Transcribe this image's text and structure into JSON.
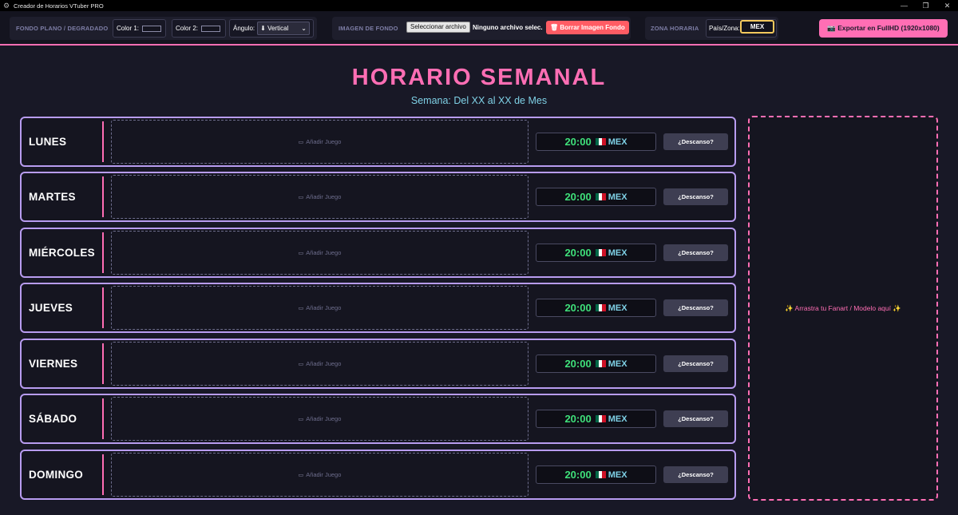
{
  "window": {
    "title": "Creador de Horarios VTuber PRO",
    "icon": "gear-icon",
    "controls": [
      "minimize-icon",
      "restore-icon",
      "close-icon"
    ]
  },
  "toolbar": {
    "bg_label": "FONDO PLANO / DEGRADADO",
    "color1_label": "Color 1:",
    "color1_value": "#14141f",
    "color2_label": "Color 2:",
    "color2_value": "#14141f",
    "angle_label": "Ángulo:",
    "angle_value": "⬇ Vertical",
    "image_label": "IMAGEN DE FONDO",
    "file_button": "Seleccionar archivo",
    "file_status": "Ninguno archivo selec.",
    "delete_image_button": "🗑 Borrar Imagen Fondo",
    "timezone_label": "ZONA HORARIA",
    "country_label": "País/Zona:",
    "country_value": "MEX",
    "export_button": "📷 Exportar en FullHD (1920x1080)"
  },
  "header": {
    "title": "HORARIO SEMANAL",
    "subtitle": "Semana: Del XX al XX de Mes"
  },
  "days": [
    {
      "name": "LUNES",
      "game_placeholder": "Añadir Juego",
      "time": "20:00",
      "zone": "MEX",
      "rest_button": "¿Descanso?"
    },
    {
      "name": "MARTES",
      "game_placeholder": "Añadir Juego",
      "time": "20:00",
      "zone": "MEX",
      "rest_button": "¿Descanso?"
    },
    {
      "name": "MIÉRCOLES",
      "game_placeholder": "Añadir Juego",
      "time": "20:00",
      "zone": "MEX",
      "rest_button": "¿Descanso?"
    },
    {
      "name": "JUEVES",
      "game_placeholder": "Añadir Juego",
      "time": "20:00",
      "zone": "MEX",
      "rest_button": "¿Descanso?"
    },
    {
      "name": "VIERNES",
      "game_placeholder": "Añadir Juego",
      "time": "20:00",
      "zone": "MEX",
      "rest_button": "¿Descanso?"
    },
    {
      "name": "SÁBADO",
      "game_placeholder": "Añadir Juego",
      "time": "20:00",
      "zone": "MEX",
      "rest_button": "¿Descanso?"
    },
    {
      "name": "DOMINGO",
      "game_placeholder": "Añadir Juego",
      "time": "20:00",
      "zone": "MEX",
      "rest_button": "¿Descanso?"
    }
  ],
  "fanart": {
    "text": "✨ Arrastra tu Fanart / Modelo aquí ✨"
  },
  "colors": {
    "accent_pink": "#ff6eb4",
    "border_purple": "#b89cf0",
    "time_green": "#3fe07a",
    "zone_cyan": "#7fd1e6",
    "flag_colors": [
      "#006847",
      "#ffffff",
      "#ce1126"
    ]
  }
}
